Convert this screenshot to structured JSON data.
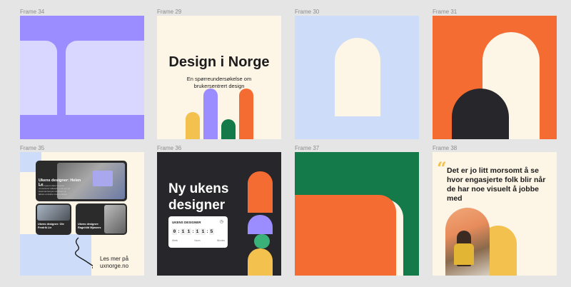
{
  "frames": {
    "f34": {
      "label": "Frame 34"
    },
    "f29": {
      "label": "Frame 29",
      "title": "Design i Norge",
      "subtitle": "En spørreundersøkelse om brukersentrert design"
    },
    "f30": {
      "label": "Frame 30"
    },
    "f31": {
      "label": "Frame 31"
    },
    "f35": {
      "label": "Frame 35",
      "card1_title": "Ukens designer: Helen Le",
      "card1_text": "Lorem ipsum dolor sit amet consectetur adipiscing elit sed do eiusmod tempor incididunt ut labore et dolore magna aliqua",
      "card2_title": "Ukens designer: Ole Fredrik Lie",
      "card3_title": "Ukens designer: Ragnhild Mjøsnes",
      "cta_line1": "Les mer på",
      "cta_line2": "uxnorge.no"
    },
    "f36": {
      "label": "Frame 36",
      "title": "Ny ukens designer",
      "timer_label": "UKENS DESIGNER",
      "digits": [
        "0",
        "1",
        "1",
        "1",
        "1",
        "5"
      ],
      "units": [
        "Week",
        "Hours",
        "Minutes"
      ]
    },
    "f37": {
      "label": "Frame 37"
    },
    "f38": {
      "label": "Frame 38",
      "quote": "Det er jo litt morsomt å se hvor engasjerte folk blir når de har noe visuelt å jobbe med"
    }
  },
  "colors": {
    "canvas": "#e5e5e5",
    "purple": "#9b8cff",
    "lavender": "#d9d6ff",
    "cream": "#fdf5e6",
    "yellow": "#f2c14e",
    "green": "#147a4a",
    "orange": "#f56c33",
    "lightblue": "#cddcf9",
    "dark": "#26262b"
  }
}
